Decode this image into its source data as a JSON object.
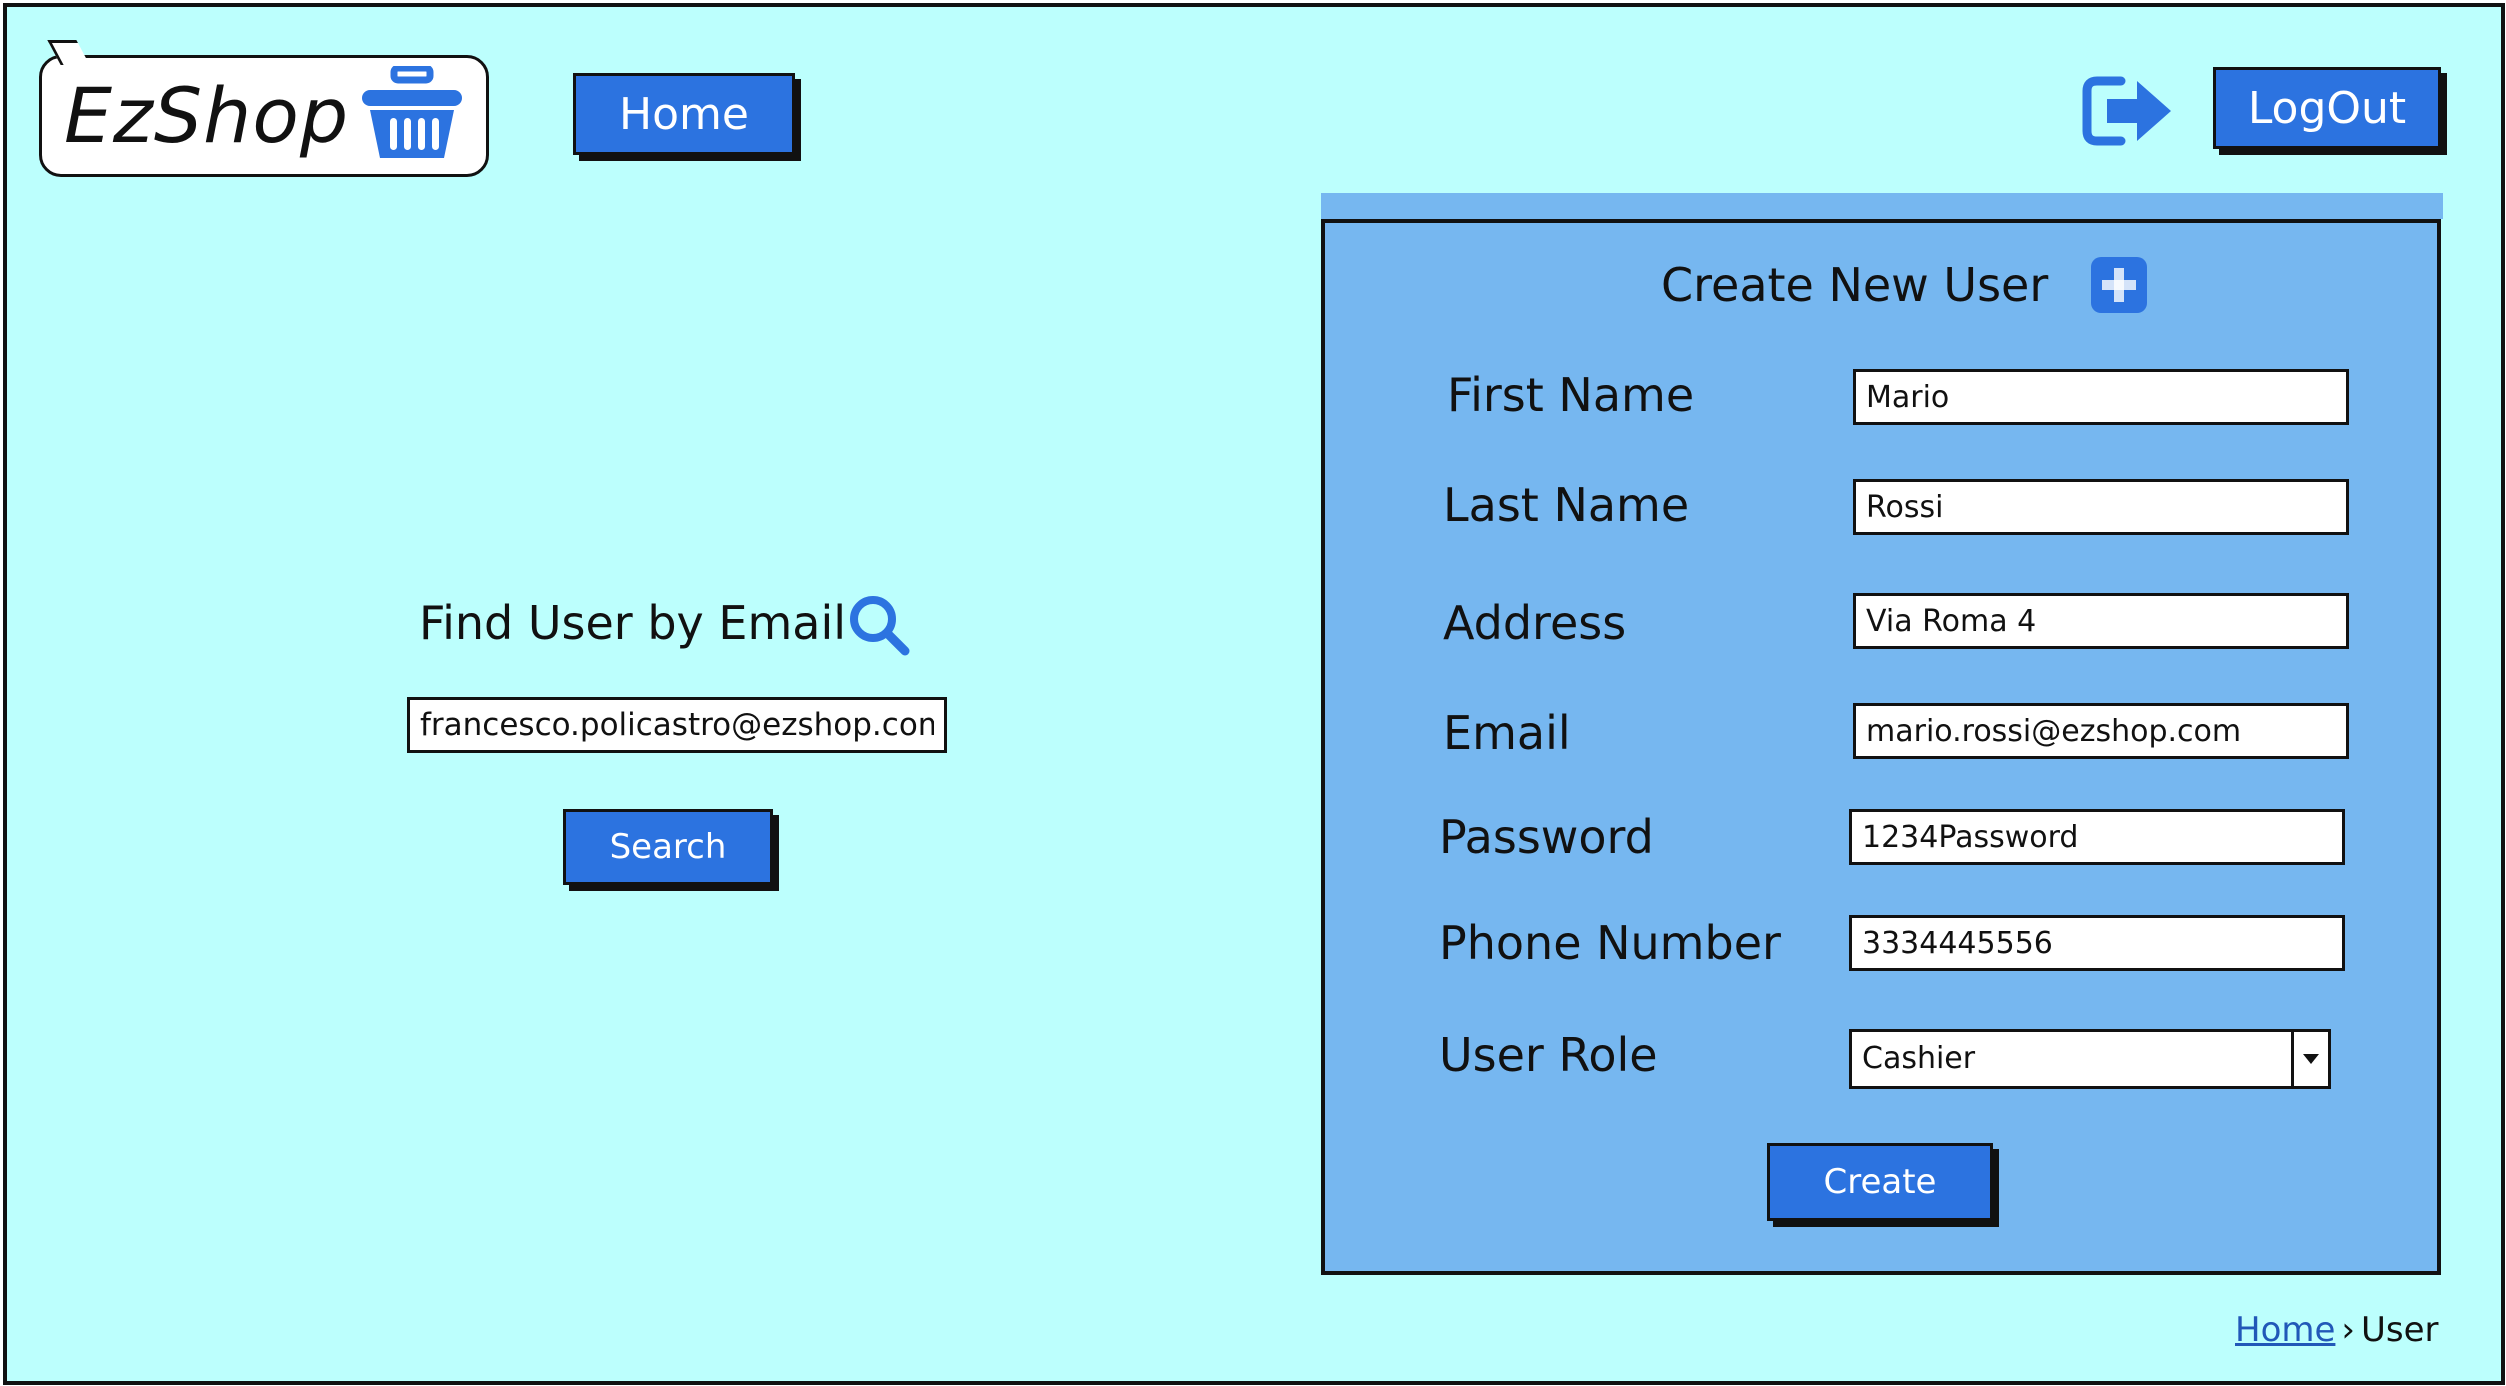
{
  "logo": {
    "text": "EzShop",
    "icon": "shopping-basket-icon",
    "icon_color": "#2c73e0"
  },
  "header": {
    "home_label": "Home",
    "logout_label": "LogOut",
    "logout_icon": "logout-icon"
  },
  "search": {
    "title": "Find User by Email",
    "icon": "magnifier-icon",
    "value": "francesco.policastro@ezshop.com",
    "button_label": "Search"
  },
  "create_user": {
    "title": "Create New User",
    "icon": "plus-icon",
    "fields": [
      {
        "label": "First Name",
        "value": "Mario"
      },
      {
        "label": "Last Name",
        "value": "Rossi"
      },
      {
        "label": "Address",
        "value": "Via Roma 4"
      },
      {
        "label": "Email",
        "value": "mario.rossi@ezshop.com"
      },
      {
        "label": "Password",
        "value": "1234Password"
      },
      {
        "label": "Phone Number",
        "value": "3334445556"
      }
    ],
    "role": {
      "label": "User Role",
      "selected": "Cashier"
    },
    "button_label": "Create"
  },
  "breadcrumb": {
    "items": [
      "Home",
      "User"
    ],
    "separator": "›"
  },
  "colors": {
    "background": "#bcfffd",
    "panel": "#76b7f0",
    "accent": "#2c73e0",
    "link": "#2158b8"
  }
}
